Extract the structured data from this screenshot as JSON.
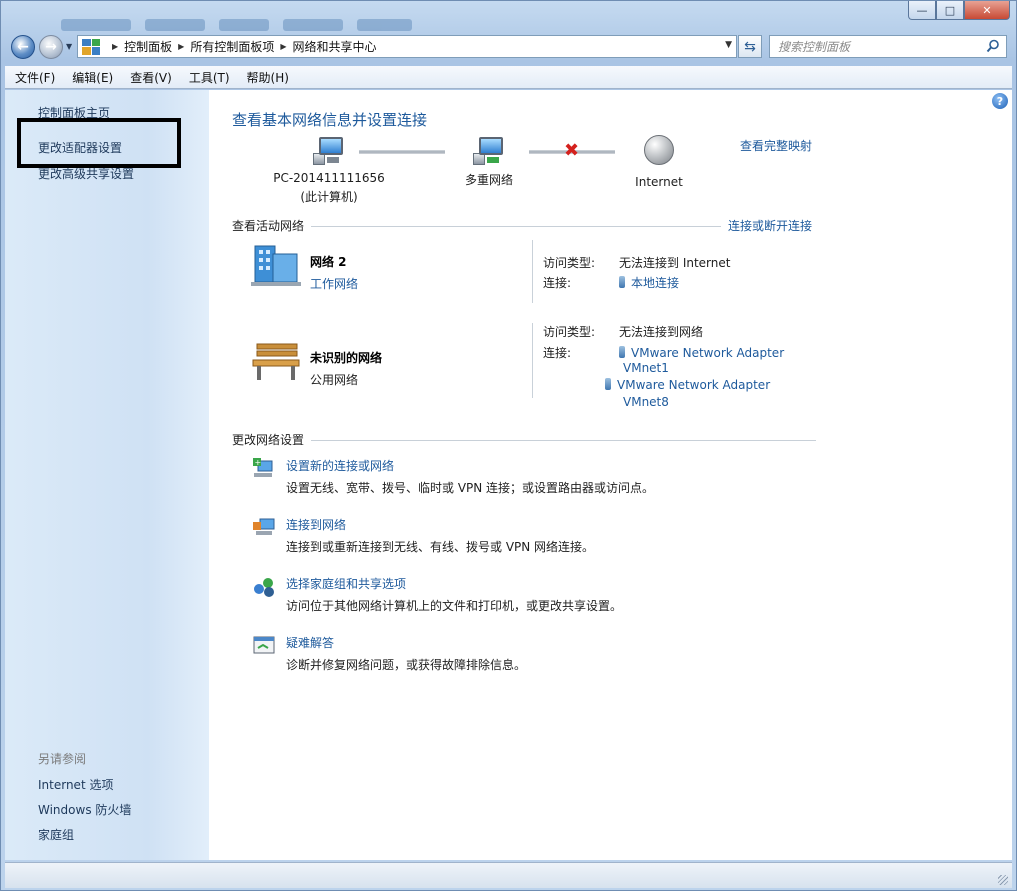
{
  "window": {
    "caption_buttons": {
      "minimize": "—",
      "maximize": "□",
      "close": "✕"
    }
  },
  "nav": {
    "breadcrumbs": [
      "控制面板",
      "所有控制面板项",
      "网络和共享中心"
    ],
    "search_placeholder": "搜索控制面板"
  },
  "menu": [
    "文件(F)",
    "编辑(E)",
    "查看(V)",
    "工具(T)",
    "帮助(H)"
  ],
  "sidebar": {
    "links": [
      "控制面板主页",
      "更改适配器设置",
      "更改高级共享设置"
    ],
    "see_also_title": "另请参阅",
    "see_also": [
      "Internet 选项",
      "Windows 防火墙",
      "家庭组"
    ]
  },
  "main": {
    "title": "查看基本网络信息并设置连接",
    "full_map_link": "查看完整映射",
    "map": {
      "pc_name": "PC-201411111656",
      "pc_sub": "(此计算机)",
      "multi_network": "多重网络",
      "internet": "Internet"
    },
    "active_section": "查看活动网络",
    "connect_disconnect": "连接或断开连接",
    "networks": [
      {
        "name": "网络  2",
        "type": "工作网络",
        "access_label": "访问类型:",
        "access_value": "无法连接到 Internet",
        "conn_label": "连接:",
        "connections": [
          "本地连接"
        ]
      },
      {
        "name": "未识别的网络",
        "type": "公用网络",
        "access_label": "访问类型:",
        "access_value": "无法连接到网络",
        "conn_label": "连接:",
        "connections": [
          "VMware Network Adapter",
          "VMnet1",
          "VMware Network Adapter",
          "VMnet8"
        ]
      }
    ],
    "change_section": "更改网络设置",
    "tasks": [
      {
        "title": "设置新的连接或网络",
        "desc": "设置无线、宽带、拨号、临时或 VPN 连接；或设置路由器或访问点。",
        "icon": "new-connection-icon"
      },
      {
        "title": "连接到网络",
        "desc": "连接到或重新连接到无线、有线、拨号或 VPN 网络连接。",
        "icon": "connect-network-icon"
      },
      {
        "title": "选择家庭组和共享选项",
        "desc": "访问位于其他网络计算机上的文件和打印机，或更改共享设置。",
        "icon": "homegroup-icon"
      },
      {
        "title": "疑难解答",
        "desc": "诊断并修复网络问题，或获得故障排除信息。",
        "icon": "troubleshoot-icon"
      }
    ]
  },
  "colors": {
    "link": "#1e5a9c",
    "sidebar": "#d4e5f6",
    "highlight_border": "#000000"
  }
}
